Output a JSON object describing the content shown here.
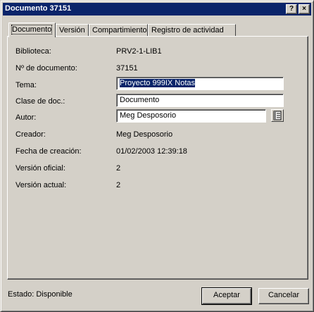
{
  "window": {
    "title": "Documento 37151",
    "help_glyph": "?",
    "close_glyph": "×"
  },
  "tabs": [
    {
      "label": "Documento",
      "active": true
    },
    {
      "label": "Versión",
      "active": false
    },
    {
      "label": "Compartimiento",
      "active": false
    },
    {
      "label": "Registro de actividad",
      "active": false
    }
  ],
  "form": {
    "biblioteca_label": "Biblioteca:",
    "biblioteca_value": "PRV2-1-LIB1",
    "numero_label": "Nº de documento:",
    "numero_value": "37151",
    "tema_label": "Tema:",
    "tema_value": "Proyecto 999IX Notas",
    "clase_label": "Clase de doc.:",
    "clase_value": "Documento",
    "autor_label": "Autor:",
    "autor_value": "Meg Desposorio",
    "creador_label": "Creador:",
    "creador_value": "Meg Desposorio",
    "fecha_label": "Fecha de creación:",
    "fecha_value": "01/02/2003 12:39:18",
    "version_oficial_label": "Versión oficial:",
    "version_oficial_value": "2",
    "version_actual_label": "Versión actual:",
    "version_actual_value": "2"
  },
  "footer": {
    "status": "Estado: Disponible",
    "ok_label": "Aceptar",
    "cancel_label": "Cancelar"
  },
  "icons": {
    "author_lookup": "address-book-icon"
  },
  "colors": {
    "titlebar": "#0a246a",
    "face": "#d4d0c8",
    "selection": "#0a246a"
  }
}
